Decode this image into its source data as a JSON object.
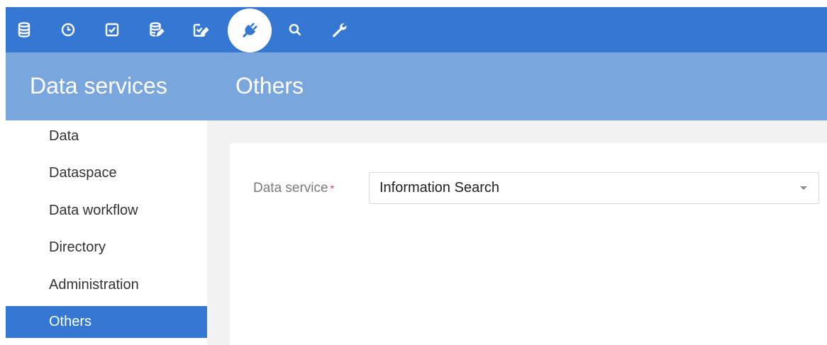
{
  "toolbar": {
    "icons": [
      {
        "name": "database-icon"
      },
      {
        "name": "clock-icon"
      },
      {
        "name": "checkbox-icon"
      },
      {
        "name": "database-edit-icon"
      },
      {
        "name": "checkbox-edit-icon"
      },
      {
        "name": "plug-icon",
        "active": true
      },
      {
        "name": "search-icon"
      },
      {
        "name": "wrench-icon"
      }
    ],
    "accent_color": "#3478d4"
  },
  "header": {
    "section_title": "Data services",
    "page_title": "Others",
    "band_color": "#7aa6de"
  },
  "sidebar": {
    "items": [
      {
        "label": "Data"
      },
      {
        "label": "Dataspace"
      },
      {
        "label": "Data workflow"
      },
      {
        "label": "Directory"
      },
      {
        "label": "Administration"
      },
      {
        "label": "Others",
        "selected": true
      }
    ]
  },
  "form": {
    "data_service_label": "Data service",
    "required_marker": "*",
    "data_service_value": "Information Search"
  }
}
